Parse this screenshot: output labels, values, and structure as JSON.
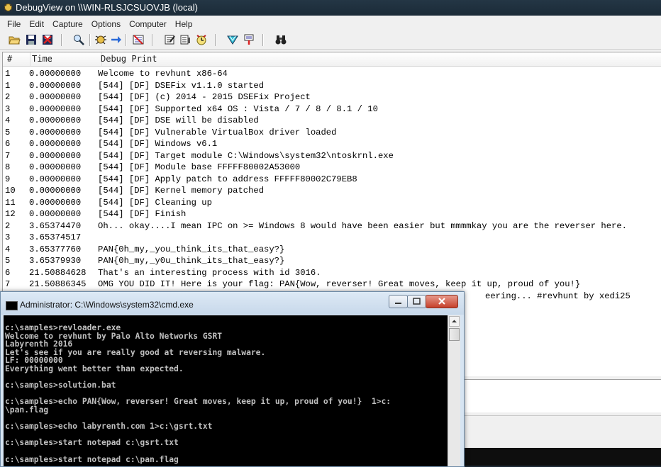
{
  "debugview": {
    "title": "DebugView on \\\\WIN-RLSJCSUOVJB (local)",
    "menu": [
      "File",
      "Edit",
      "Capture",
      "Options",
      "Computer",
      "Help"
    ],
    "toolbar_icons": [
      "open-icon",
      "save-icon",
      "clear-icon",
      "find-icon",
      "capture-icon",
      "autoscroll-icon",
      "clear-display-icon",
      "filter-icon",
      "highlight-icon",
      "history-icon",
      "time-icon",
      "capture-kernel-icon",
      "pass-through-icon",
      "binoculars-icon"
    ],
    "columns": [
      "#",
      "Time",
      "Debug Print"
    ],
    "rows": [
      {
        "num": "1",
        "time": "0.00000000",
        "msg": "Welcome to revhunt x86-64"
      },
      {
        "num": "1",
        "time": "0.00000000",
        "msg": "[544] [DF] DSEFix v1.1.0 started"
      },
      {
        "num": "2",
        "time": "0.00000000",
        "msg": "[544] [DF] (c) 2014 - 2015 DSEFix Project"
      },
      {
        "num": "3",
        "time": "0.00000000",
        "msg": "[544] [DF] Supported x64 OS : Vista / 7 / 8 / 8.1 / 10"
      },
      {
        "num": "4",
        "time": "0.00000000",
        "msg": "[544] [DF] DSE will be disabled"
      },
      {
        "num": "5",
        "time": "0.00000000",
        "msg": "[544] [DF] Vulnerable VirtualBox driver loaded"
      },
      {
        "num": "6",
        "time": "0.00000000",
        "msg": "[544] [DF] Windows v6.1"
      },
      {
        "num": "7",
        "time": "0.00000000",
        "msg": "[544] [DF] Target module C:\\Windows\\system32\\ntoskrnl.exe"
      },
      {
        "num": "8",
        "time": "0.00000000",
        "msg": "[544] [DF] Module base FFFFF80002A53000"
      },
      {
        "num": "9",
        "time": "0.00000000",
        "msg": "[544] [DF] Apply patch to address FFFFF80002C79EB8"
      },
      {
        "num": "10",
        "time": "0.00000000",
        "msg": "[544] [DF] Kernel memory patched"
      },
      {
        "num": "11",
        "time": "0.00000000",
        "msg": "[544] [DF] Cleaning up"
      },
      {
        "num": "12",
        "time": "0.00000000",
        "msg": "[544] [DF] Finish"
      },
      {
        "num": "2",
        "time": "3.65374470",
        "msg": "Oh... okay....I mean IPC on >= Windows 8 would have been easier but mmmmkay you are the reverser here."
      },
      {
        "num": "3",
        "time": "3.65374517",
        "msg": ""
      },
      {
        "num": "4",
        "time": "3.65377760",
        "msg": "PAN{0h_my,_you_think_its_that_easy?}"
      },
      {
        "num": "5",
        "time": "3.65379930",
        "msg": "PAN{0h_my,_y0u_think_its_that_easy?}"
      },
      {
        "num": "6",
        "time": "21.50884628",
        "msg": "That's an interesting process with id 3016."
      },
      {
        "num": "7",
        "time": "21.50886345",
        "msg": "OMG YOU DID IT! Here is your flag: PAN{Wow, reverser! Great moves, keep it up, proud of you!}"
      },
      {
        "num": "",
        "time": "",
        "msg": "eering... #revhunt by xedi25"
      }
    ]
  },
  "cmd": {
    "title": "Administrator: C:\\Windows\\system32\\cmd.exe",
    "lines": [
      "c:\\samples>revloader.exe",
      "Welcome to revhunt by Palo Alto Networks GSRT",
      "Labyrenth 2016",
      "Let's see if you are really good at reversing malware.",
      "LF: 00000000",
      "Everything went better than expected.",
      "",
      "c:\\samples>solution.bat",
      "",
      "c:\\samples>echo PAN{Wow, reverser! Great moves, keep it up, proud of you!}  1>c:",
      "\\pan.flag",
      "",
      "c:\\samples>echo labyrenth.com 1>c:\\gsrt.txt",
      "",
      "c:\\samples>start notepad c:\\gsrt.txt",
      "",
      "c:\\samples>start notepad c:\\pan.flag"
    ]
  }
}
